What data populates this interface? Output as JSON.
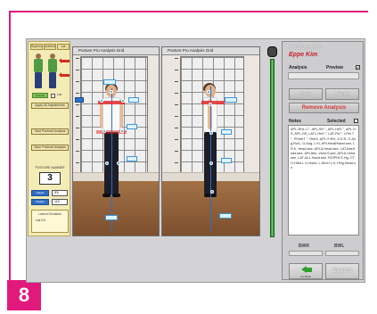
{
  "page_number": "8",
  "left_panel": {
    "tabs": [
      "Superior",
      "Anterior",
      "Lat"
    ],
    "green_button": "Anterior",
    "check_label": "Lat",
    "buttons": [
      "Apply All Adjustments",
      "Start Postural Analysis",
      "Save Postural Analysis"
    ],
    "posture_number_label": "POSTURE NUMBER",
    "posture_number": "3",
    "rows": [
      {
        "label": "Height",
        "value": "5'6"
      },
      {
        "label": "Weight",
        "value": "115"
      }
    ],
    "bottom_title": "Lateral Deviation",
    "bottom_value": "Lat 0.0"
  },
  "photos": [
    {
      "title": "Posture Pro Analysis Grid"
    },
    {
      "title": "Posture Pro Analysis Grid"
    }
  ],
  "right_panel": {
    "title": "Posture Pro",
    "patient_name": "Eppe Kim",
    "analysis_label": "Analysis",
    "preview_label": "Preview",
    "preview_check": "✔",
    "prev_label": "Prev",
    "next_label": "Next",
    "remove_label": "Remove Analysis",
    "notes_label": "Notes",
    "selected_label": "Selected",
    "notes_text": "APL-RHL-C°, APL-SH °, APL-HeS °, APL-HS, APL-HS, LATL-HeS °, LAT-Pel °, LPel T °, PSHelT °, RheS, APL-S.RH, S.S R, G.Ang.Ro/L, G.Ang, L.Ki, APLHealt/Hand.see, LR.K, Head.see, APLA.Head.see, LAT.AbsHead.see, APLAbs, Vshd.S.see, APLA.Vshd.see, LAT-ALL.Hand.see, RO/PHLS.Hg, CTO.Hthd.t, Lt.Hshd, L.Hhd.t 1.9, HHg.Head.on",
    "bwr_label": "BWR",
    "bwl_label": "BWL",
    "back_label": "Go Back",
    "export_label": "Export"
  },
  "accent_color": "#e2197c",
  "icons": {
    "back": "green-left-arrow-icon",
    "slider": "vertical-slider-icon"
  }
}
